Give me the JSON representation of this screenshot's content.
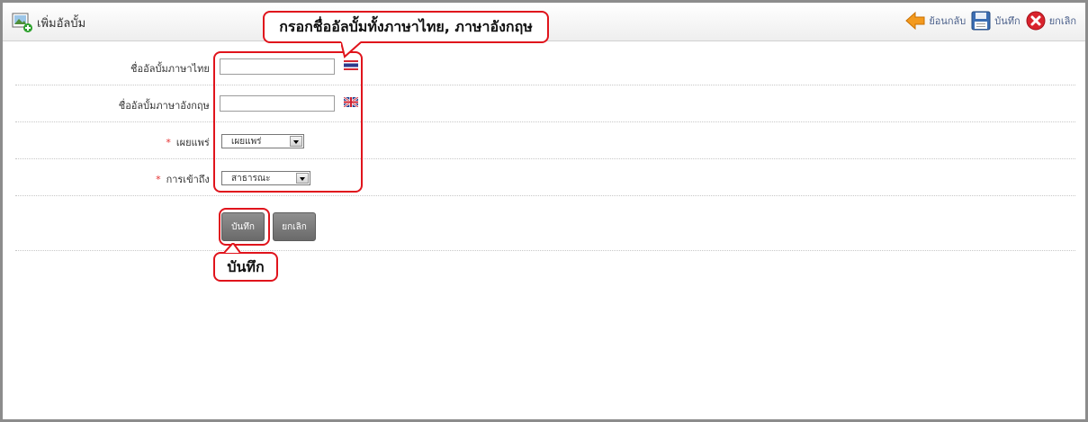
{
  "header": {
    "title": "เพิ่มอัลบั้ม",
    "icon": "photo-add-icon",
    "back_label": "ย้อนกลับ",
    "save_label": "บันทึก",
    "cancel_label": "ยกเลิก"
  },
  "form": {
    "name_th_label": "ชื่ออัลบั้มภาษาไทย :",
    "name_th_value": "",
    "name_en_label": "ชื่ออัลบั้มภาษาอังกฤษ :",
    "name_en_value": "",
    "publish_label": "เผยแพร่ :",
    "publish_value": "เผยแพร่",
    "access_label": "การเข้าถึง :",
    "access_value": "สาธารณะ",
    "required_mark": "*",
    "save_button": "บันทึก",
    "cancel_button": "ยกเลิก"
  },
  "annotations": {
    "callout_top": "กรอกชื่ออัลบั้มทั้งภาษาไทย, ภาษาอังกฤษ",
    "callout_save": "บันทึก"
  },
  "colors": {
    "highlight": "#e0141c",
    "required": "#e53030",
    "button": "#7a7a7a",
    "link": "#4a5f8a"
  }
}
